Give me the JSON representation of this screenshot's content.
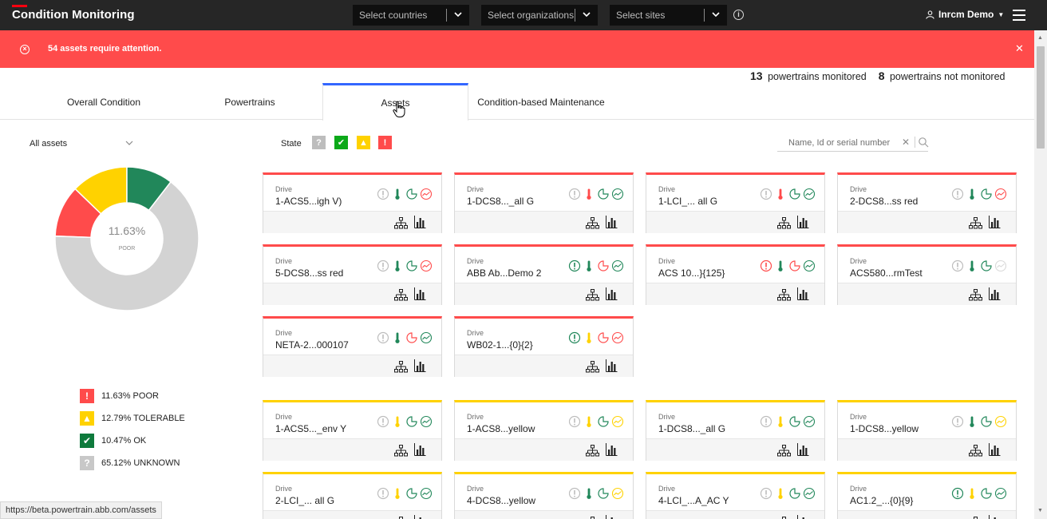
{
  "app": {
    "title": "Condition Monitoring",
    "selectors": [
      {
        "placeholder": "Select countries"
      },
      {
        "placeholder": "Select organizations"
      },
      {
        "placeholder": "Select sites"
      }
    ],
    "user": "Inrcm Demo"
  },
  "alert": {
    "message": "54 assets require attention.",
    "color": "#ff4b4b"
  },
  "counters": {
    "monitored_count": "13",
    "monitored_label": "powertrains monitored",
    "not_monitored_count": "8",
    "not_monitored_label": "powertrains not monitored"
  },
  "tabs": [
    {
      "label": "Overall Condition",
      "active": false
    },
    {
      "label": "Powertrains",
      "active": false
    },
    {
      "label": "Assets",
      "active": true
    },
    {
      "label": "Condition-based Maintenance",
      "active": false
    }
  ],
  "filter": {
    "assets_select": "All assets"
  },
  "state_filter": {
    "label": "State",
    "buttons": [
      {
        "state": "unknown",
        "glyph": "?",
        "color": "#bdbdbd"
      },
      {
        "state": "ok",
        "glyph": "✔",
        "color": "#0ca919"
      },
      {
        "state": "tolerable",
        "glyph": "▲",
        "color": "#ffd200"
      },
      {
        "state": "poor",
        "glyph": "!",
        "color": "#ff4b4b"
      }
    ]
  },
  "search": {
    "placeholder": "Name, Id or serial number"
  },
  "chart_data": {
    "type": "pie",
    "center_value": "11.63%",
    "center_label": "POOR",
    "slices": [
      {
        "label": "POOR",
        "value": 11.63,
        "color": "#ff4b4b"
      },
      {
        "label": "TOLERABLE",
        "value": 12.79,
        "color": "#ffd200"
      },
      {
        "label": "OK",
        "value": 10.47,
        "color": "#21875a"
      },
      {
        "label": "UNKNOWN",
        "value": 65.12,
        "color": "#d3d3d3"
      }
    ]
  },
  "legend": [
    {
      "text": "11.63% POOR",
      "glyph": "!",
      "color": "#ff4b4b"
    },
    {
      "text": "12.79% TOLERABLE",
      "glyph": "▲",
      "color": "#ffd200"
    },
    {
      "text": "10.47% OK",
      "glyph": "✔",
      "color": "#0e7a3c"
    },
    {
      "text": "65.12% UNKNOWN",
      "glyph": "?",
      "color": "#c8c8c8"
    }
  ],
  "cards": [
    {
      "type": "Drive",
      "name": "1-ACS5...igh V)",
      "border": "red"
    },
    {
      "type": "Drive",
      "name": "1-DCS8..._all G",
      "border": "red"
    },
    {
      "type": "Drive",
      "name": "1-LCI_... all G",
      "border": "red"
    },
    {
      "type": "Drive",
      "name": "2-DCS8...ss red",
      "border": "red"
    },
    {
      "type": "Drive",
      "name": "5-DCS8...ss red",
      "border": "red"
    },
    {
      "type": "Drive",
      "name": "ABB Ab...Demo 2",
      "border": "red"
    },
    {
      "type": "Drive",
      "name": "ACS 10...}{125}",
      "border": "red"
    },
    {
      "type": "Drive",
      "name": "ACS580...rmTest",
      "border": "red"
    },
    {
      "type": "Drive",
      "name": "NETA-2...000107",
      "border": "red"
    },
    {
      "type": "Drive",
      "name": "WB02-1...{0}{2}",
      "border": "red"
    },
    {
      "type": "Drive",
      "name": "1-ACS5..._env Y",
      "border": "yellow"
    },
    {
      "type": "Drive",
      "name": "1-ACS8...yellow",
      "border": "yellow"
    },
    {
      "type": "Drive",
      "name": "1-DCS8..._all G",
      "border": "yellow"
    },
    {
      "type": "Drive",
      "name": "1-DCS8...yellow",
      "border": "yellow"
    },
    {
      "type": "Drive",
      "name": "2-LCI_... all G",
      "border": "yellow"
    },
    {
      "type": "Drive",
      "name": "4-DCS8...yellow",
      "border": "yellow"
    },
    {
      "type": "Drive",
      "name": "4-LCI_...A_AC Y",
      "border": "yellow"
    },
    {
      "type": "Drive",
      "name": "AC1.2_...{0}{9}",
      "border": "yellow"
    }
  ],
  "status_url": "https://beta.powertrain.abb.com/assets"
}
